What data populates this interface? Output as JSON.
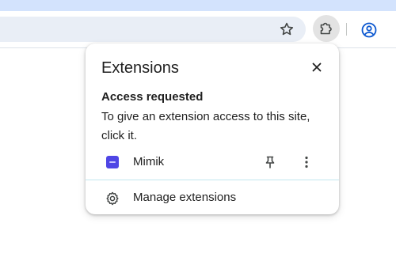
{
  "toolbar": {
    "star_icon": "star-icon",
    "extensions_icon": "puzzle-piece-icon",
    "profile_icon": "account-circle-icon"
  },
  "popup": {
    "title": "Extensions",
    "close_icon": "close-icon",
    "section_heading": "Access requested",
    "section_description": "To give an extension access to this site, click it.",
    "extensions": [
      {
        "name": "Mimik",
        "icon_color": "#4f46e5",
        "pin_icon": "pin-icon",
        "more_icon": "more-vertical-icon"
      }
    ],
    "manage_label": "Manage extensions",
    "manage_icon": "gear-icon"
  },
  "colors": {
    "titlebar": "#d3e3fd",
    "omnibox": "#e9eef6",
    "profile_accent": "#0b57d0"
  }
}
